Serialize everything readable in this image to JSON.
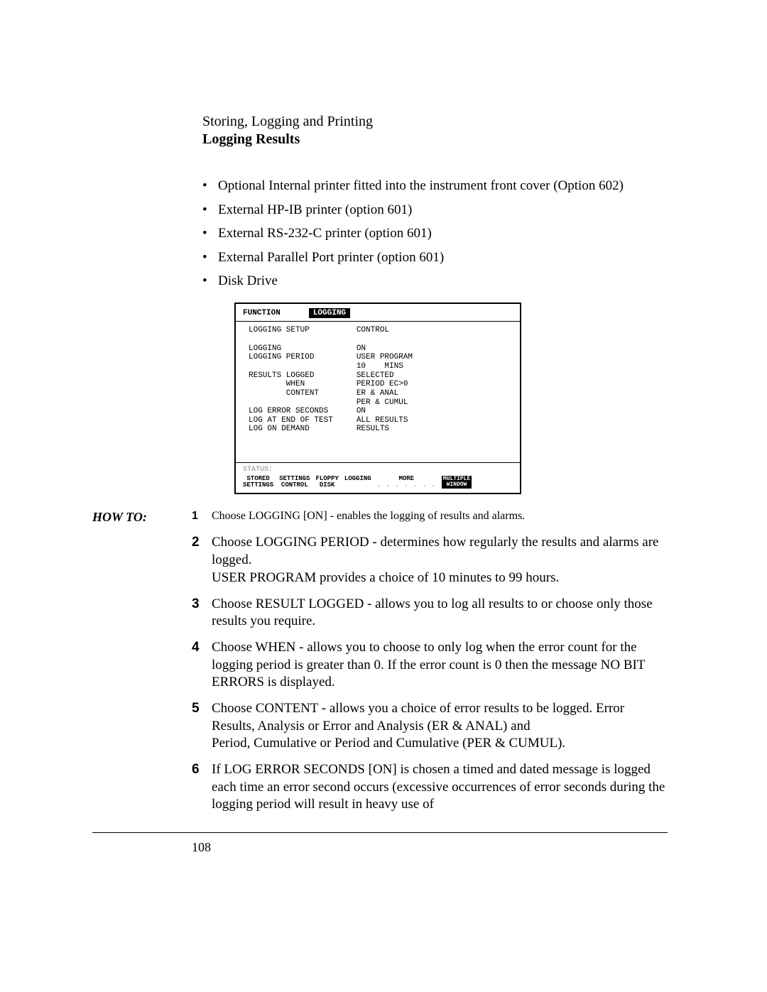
{
  "header": {
    "line1": "Storing, Logging and Printing",
    "line2": "Logging Results"
  },
  "bullets": [
    "Optional Internal printer fitted into the instrument front cover (Option 602)",
    "External HP-IB printer (option 601)",
    "External RS-232-C printer (option 601)",
    "External Parallel Port printer (option 601)",
    "Disk Drive"
  ],
  "screenshot": {
    "function_label": "FUNCTION",
    "function_tag": "LOGGING",
    "body_text": "LOGGING SETUP          CONTROL\n\nLOGGING                ON\nLOGGING PERIOD         USER PROGRAM\n                       10    MINS\nRESULTS LOGGED         SELECTED\n        WHEN           PERIOD EC>0\n        CONTENT        ER & ANAL\n                       PER & CUMUL\nLOG ERROR SECONDS      ON\nLOG AT END OF TEST     ALL RESULTS\nLOG ON DEMAND          RESULTS",
    "status_label": "STATUS:",
    "tabs": {
      "t1a": "STORED",
      "t1b": "SETTINGS",
      "t2a": "SETTINGS",
      "t2b": "CONTROL",
      "t3a": "FLOPPY",
      "t3b": "DISK",
      "t4": "LOGGING",
      "t5": "MORE",
      "dots": ". . . . . . .",
      "t6a": "MULTIPLE",
      "t6b": "WINDOW"
    }
  },
  "howto_label": "HOW TO:",
  "steps": [
    {
      "n": "1",
      "t": "Choose LOGGING [ON] - enables the logging of results and alarms."
    },
    {
      "n": "2",
      "t": "Choose LOGGING PERIOD - determines how regularly the results and alarms are logged.\nUSER PROGRAM provides a choice of 10 minutes to 99 hours."
    },
    {
      "n": "3",
      "t": "Choose RESULT LOGGED - allows you to log all results to or choose only those results you require."
    },
    {
      "n": "4",
      "t": "Choose WHEN - allows you to choose to only log when the error count for the logging period is greater than 0. If the error count is 0 then the message NO BIT ERRORS is displayed."
    },
    {
      "n": "5",
      "t": "Choose CONTENT - allows you a choice of error results to be logged. Error Results, Analysis or Error and Analysis (ER & ANAL) and\nPeriod, Cumulative or Period and Cumulative (PER & CUMUL)."
    },
    {
      "n": "6",
      "t": "If LOG ERROR SECONDS [ON] is chosen a timed and dated message is logged each time an error second occurs (excessive occurrences of error seconds during the logging period will result in heavy use of"
    }
  ],
  "page_number": "108"
}
